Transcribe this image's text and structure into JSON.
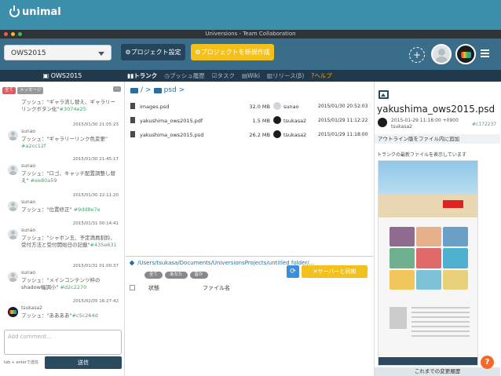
{
  "brand": {
    "name": "unimal",
    "accent": "#3b8fab"
  },
  "window": {
    "title": "Universions - Team Collaboration"
  },
  "toolbar": {
    "project_selected": "OWS2015",
    "settings_label": "プロジェクト設定",
    "new_project_label": "プロジェクトを新規作成"
  },
  "nav": {
    "project": "OWS2015",
    "tabs": [
      "トランク",
      "プッシュ履歴",
      "タスク",
      "Wiki",
      "リリース(β)",
      "ヘルプ"
    ]
  },
  "sidebar": {
    "filters": [
      "全て",
      "メッセージ"
    ],
    "messages": [
      {
        "time": "",
        "user": "",
        "text": "プッシュ：\"ギャラ流し替え、ギャラリーリンクボタン化\"",
        "hash": "#3074e25"
      },
      {
        "time": "2015/01/30 21:05:23",
        "user": "sunao",
        "text": "プッシュ：\"ギャラリーリンク色変更\"",
        "hash": "#a2cc12f"
      },
      {
        "time": "2015/01/30 21:45:17",
        "user": "sunao",
        "text": "プッシュ：\"ロゴ、キャッチ配置調整し替え\"",
        "hash": "#ee80a59"
      },
      {
        "time": "2015/01/30 22:11:20",
        "user": "sunao",
        "text": "プッシュ：\"位置修正\"",
        "hash": "#9dd8e7e"
      },
      {
        "time": "2015/01/31 00:14:41",
        "user": "sunao",
        "text": "プッシュ：\"シャボン玉、予定満員割鈴、受付方法と受付開始日の記載\"",
        "hash": "#435e631"
      },
      {
        "time": "2015/01/31 01:00:37",
        "user": "sunao",
        "text": "プッシュ：\"メインコンテンツ枠のshadow幅調小\"",
        "hash": "#d2c2270"
      },
      {
        "time": "2015/02/05 16:27:42",
        "user": "tsukasa2",
        "text": "プッシュ：\"ああああ\"",
        "hash": "#c5c264d"
      }
    ],
    "comment_placeholder": "Add comment...",
    "send_hint": "tab + enterで送信",
    "send_label": "送信"
  },
  "files": {
    "breadcrumb": [
      "/",
      ">",
      "psd",
      ">"
    ],
    "rows": [
      {
        "name": "images.psd",
        "size": "32.0 MB",
        "user": "sunao",
        "date": "2015/01/30 20:52:03"
      },
      {
        "name": "yakushima_ows2015.pdf",
        "size": "1.5 MB",
        "user": "tsukasa2",
        "date": "2015/01/29 11:12:22"
      },
      {
        "name": "yakushima_ows2015.psd",
        "size": "26.2 MB",
        "user": "tsukasa2",
        "date": "2015/01/29 11:18:00"
      }
    ],
    "local_path": "/Users/tsukasa/Documents/UniversionsProjects/untitled folder/...",
    "sync_label": "サーバーと同期",
    "filter_chips": [
      "全て",
      "あなた",
      "皆か"
    ],
    "head_status": "状態",
    "head_filename": "ファイル名"
  },
  "preview": {
    "title": "yakushima_ows2015.psd",
    "date": "2015-01-29 11:18:00 +0900",
    "user": "tsukasa2",
    "hash": "#c172237",
    "outline_btn": "アウトライン版をファイル内に追加",
    "description": "トランクの最新ファイルを表示しています",
    "history_label": "これまでの変更履歴"
  }
}
